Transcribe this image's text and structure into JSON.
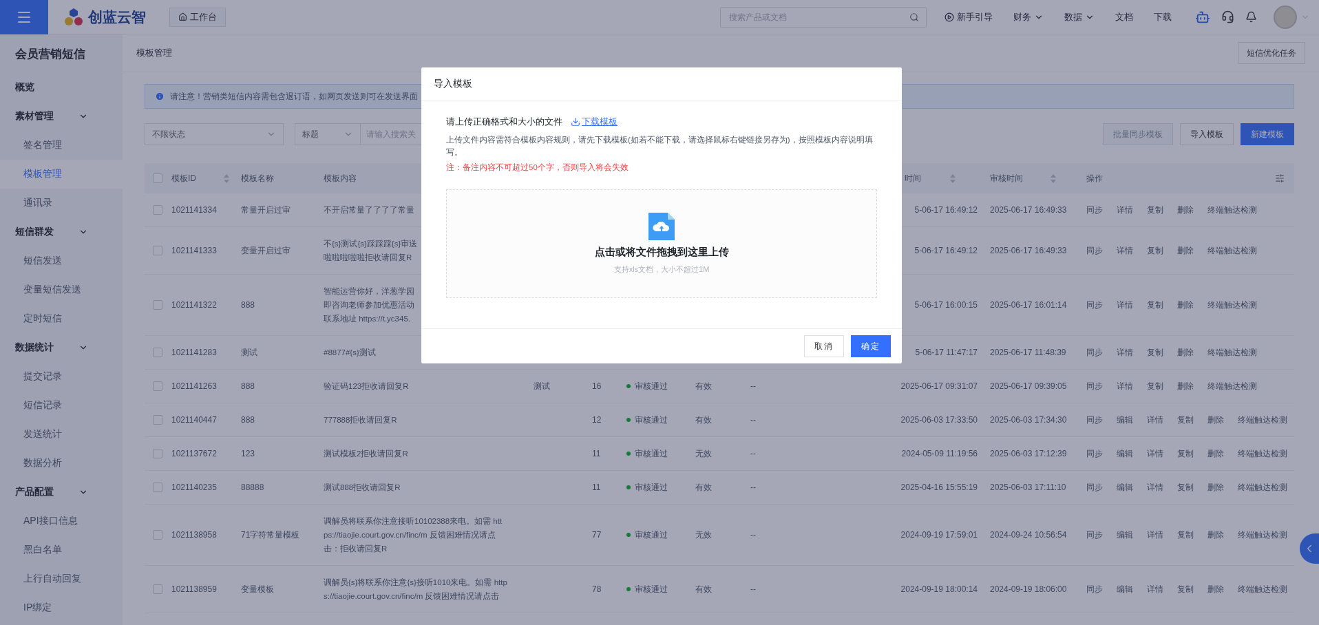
{
  "topbar": {
    "logo": "创蓝云智",
    "workbench_tab": "工作台",
    "search": {
      "placeholder": "搜索产品或文档"
    },
    "nav": [
      {
        "label": "新手引导",
        "kind": "guide"
      },
      {
        "label": "财务",
        "kind": "dropdown"
      },
      {
        "label": "数据",
        "kind": "dropdown"
      },
      {
        "label": "文档",
        "kind": "link"
      },
      {
        "label": "下载",
        "kind": "link"
      }
    ]
  },
  "sidebar": {
    "title": "会员营销短信",
    "items": [
      {
        "label": "概览",
        "selected": false
      },
      {
        "label": "素材管理",
        "expanded": true,
        "children": [
          {
            "label": "签名管理",
            "selected": false
          },
          {
            "label": "模板管理",
            "selected": true
          },
          {
            "label": "通讯录",
            "selected": false
          }
        ]
      },
      {
        "label": "短信群发",
        "expanded": true,
        "children": [
          {
            "label": "短信发送",
            "selected": false
          },
          {
            "label": "变量短信发送",
            "selected": false
          },
          {
            "label": "定时短信",
            "selected": false
          }
        ]
      },
      {
        "label": "数据统计",
        "expanded": true,
        "children": [
          {
            "label": "提交记录",
            "selected": false
          },
          {
            "label": "短信记录",
            "selected": false
          },
          {
            "label": "发送统计",
            "selected": false
          },
          {
            "label": "数据分析",
            "selected": false
          }
        ]
      },
      {
        "label": "产品配置",
        "expanded": true,
        "children": [
          {
            "label": "API接口信息",
            "selected": false
          },
          {
            "label": "黑白名单",
            "selected": false
          },
          {
            "label": "上行自动回复",
            "selected": false
          },
          {
            "label": "IP绑定",
            "selected": false
          }
        ]
      }
    ]
  },
  "page": {
    "breadcrumb": "模板管理",
    "task_button": "短信优化任务",
    "notice": "请注意！营销类短信内容需包含退订语，如网页发送则可在发送界面",
    "filters": {
      "status": "不限状态",
      "field": "标题",
      "search_placeholder": "请输入搜索关"
    },
    "buttons": [
      {
        "label": "批量同步模板",
        "kind": "default",
        "disabled": true
      },
      {
        "label": "导入模板",
        "kind": "default",
        "disabled": false
      },
      {
        "label": "新建模板",
        "kind": "primary",
        "disabled": false
      }
    ]
  },
  "table": {
    "header_checked": false,
    "columns": {
      "id": {
        "label": "模板ID",
        "sortable": true
      },
      "name": {
        "label": "模板名称"
      },
      "content": {
        "label": "模板内容"
      },
      "created": {
        "label": "时间",
        "sortable": true
      },
      "audited": {
        "label": "审核时间",
        "sortable": true
      },
      "actions": {
        "label": "操作"
      }
    },
    "rows": [
      {
        "checked": false,
        "id": "1021141334",
        "name": "常量开启过审",
        "content": [
          "不开启常量了了了了常量"
        ],
        "created": "5-06-17 16:49:12",
        "audited": "2025-06-17 16:49:33",
        "actions": [
          "同步",
          "详情",
          "复制",
          "删除",
          "终端触达检测"
        ]
      },
      {
        "checked": false,
        "id": "1021141333",
        "name": "变量开启过审",
        "content": [
          "不{s}测试{s}踩踩踩{s}审送",
          "啦啦啦啦啦拒收请回复R"
        ],
        "created": "5-06-17 16:49:12",
        "audited": "2025-06-17 16:49:33",
        "actions": [
          "同步",
          "详情",
          "复制",
          "删除",
          "终端触达检测"
        ]
      },
      {
        "checked": false,
        "id": "1021141322",
        "name": "888",
        "content": [
          "智能运营你好，洋葱学园",
          "即咨询老师参加优惠活动",
          "联系地址 https://t.yc345."
        ],
        "created": "5-06-17 16:00:15",
        "audited": "2025-06-17 16:01:14",
        "actions": [
          "同步",
          "详情",
          "复制",
          "删除",
          "终端触达检测"
        ]
      },
      {
        "checked": false,
        "id": "1021141283",
        "name": "测试",
        "content": [
          "#8877#{s}测试"
        ],
        "created": "5-06-17 11:47:17",
        "audited": "2025-06-17 11:48:39",
        "actions": [
          "同步",
          "详情",
          "复制",
          "删除",
          "终端触达检测"
        ]
      },
      {
        "checked": false,
        "id": "1021141263",
        "name": "888",
        "content": [
          "验证码123拒收请回复R"
        ],
        "column_5": "测试",
        "count": "16",
        "status": "审核通过",
        "validity": "有效",
        "remark": "--",
        "created": "2025-06-17 09:31:07",
        "audited": "2025-06-17 09:39:05",
        "actions": [
          "同步",
          "详情",
          "复制",
          "删除",
          "终端触达检测"
        ]
      },
      {
        "checked": false,
        "id": "1021140447",
        "name": "888",
        "content": [
          "777888拒收请回复R"
        ],
        "count": "12",
        "status": "审核通过",
        "validity": "有效",
        "remark": "--",
        "created": "2025-06-03 17:33:50",
        "audited": "2025-06-03 17:34:30",
        "actions": [
          "同步",
          "编辑",
          "详情",
          "复制",
          "删除",
          "终端触达检测"
        ]
      },
      {
        "checked": false,
        "id": "1021137672",
        "name": "123",
        "content": [
          "测试模板2拒收请回复R"
        ],
        "count": "11",
        "status": "审核通过",
        "validity": "无效",
        "remark": "--",
        "created": "2024-05-09 11:19:56",
        "audited": "2025-06-03 17:12:39",
        "actions": [
          "同步",
          "编辑",
          "详情",
          "复制",
          "删除",
          "终端触达检测"
        ]
      },
      {
        "checked": false,
        "id": "1021140235",
        "name": "88888",
        "content": [
          "测试888拒收请回复R"
        ],
        "count": "11",
        "status": "审核通过",
        "validity": "有效",
        "remark": "--",
        "created": "2025-04-16 15:55:19",
        "audited": "2025-06-03 17:11:10",
        "actions": [
          "同步",
          "编辑",
          "详情",
          "复制",
          "删除",
          "终端触达检测"
        ]
      },
      {
        "checked": false,
        "id": "1021138958",
        "name": "71字符常量模板",
        "content": [
          "调解员将联系你注意接听10102388来电。如需 htt",
          "ps://tiaojie.court.gov.cn/finc/m 反馈困难情况请点",
          "击：拒收请回复R"
        ],
        "count": "77",
        "status": "审核通过",
        "validity": "无效",
        "remark": "--",
        "created": "2024-09-19 17:59:01",
        "audited": "2024-09-24 10:56:54",
        "actions": [
          "同步",
          "编辑",
          "详情",
          "复制",
          "删除",
          "终端触达检测"
        ]
      },
      {
        "checked": false,
        "id": "1021138959",
        "name": "变量模板",
        "content": [
          "调解员{s}将联系你注意{s}接听1010来电。如需 http",
          "s://tiaojie.court.gov.cn/finc/m 反馈困难情况请点击"
        ],
        "count": "78",
        "status": "审核通过",
        "validity": "有效",
        "remark": "--",
        "created": "2024-09-19 18:00:14",
        "audited": "2024-09-19 18:06:00",
        "actions": [
          "同步",
          "编辑",
          "详情",
          "复制",
          "删除",
          "终端触达检测"
        ]
      }
    ]
  },
  "dialog": {
    "title": "导入模板",
    "prompt": "请上传正确格式和大小的文件",
    "download_link": "下载模板",
    "description": "上传文件内容需符合模板内容规则，请先下载模板(如若不能下载，请选择鼠标右键链接另存为)，按照模板内容说明填写。",
    "note": "注：备注内容不可超过50个字，否则导入将会失效",
    "dropzone": {
      "title": "点击或将文件拖拽到这里上传",
      "hint": "支持xls文档，大小不超过1M"
    },
    "buttons": [
      {
        "label": "取消",
        "kind": "default"
      },
      {
        "label": "确定",
        "kind": "primary"
      }
    ]
  }
}
